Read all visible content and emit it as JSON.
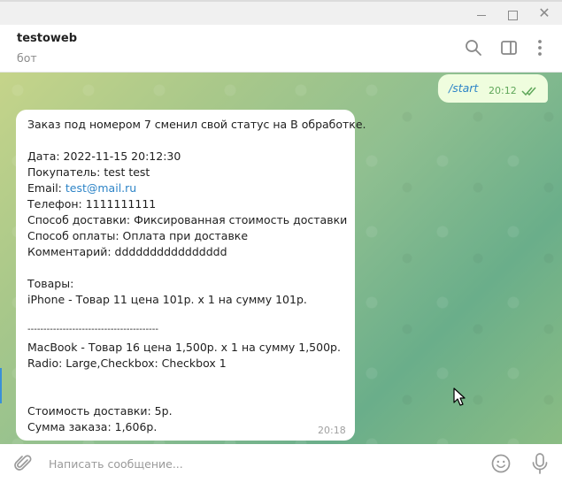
{
  "window_controls": {
    "close_glyph": "✕"
  },
  "header": {
    "title": "testoweb",
    "status": "бот",
    "icons": [
      "search-icon",
      "sidebar-panel-icon",
      "more-vertical-icon"
    ]
  },
  "messages": {
    "outgoing": {
      "text": "/start",
      "time": "20:12",
      "status_icon": "double-check-icon"
    },
    "incoming": {
      "lines": [
        "Заказ под номером 7 сменил свой статус на В обработке.",
        "",
        "Дата: 2022-11-15 20:12:30",
        "Покупатель: test test",
        "Email: ",
        "Телефон: 1111111111",
        "Способ доставки: Фиксированная стоимость доставки",
        "Способ оплаты: Оплата при доставке",
        "Комментарий: dddddddddddddddd",
        "",
        "Товары:",
        "iPhone - Товар 11 цена 101р. x 1 на сумму 101р.",
        "",
        "-----------------------------------------",
        "MacBook - Товар 16 цена 1,500р. x 1 на сумму 1,500р.",
        "Radio: Large,Checkbox: Checkbox 1",
        "",
        "",
        "Стоимость доставки: 5р.",
        "Сумма заказа: 1,606р."
      ],
      "email_link": "test@mail.ru",
      "time": "20:18"
    }
  },
  "composer": {
    "placeholder": "Написать сообщение...",
    "value": "",
    "icons": [
      "paperclip-icon",
      "emoji-icon",
      "microphone-icon"
    ]
  },
  "colors": {
    "outgoing_bubble": "#effdde",
    "link": "#2d84c7",
    "time_outgoing": "#5fa75a"
  }
}
